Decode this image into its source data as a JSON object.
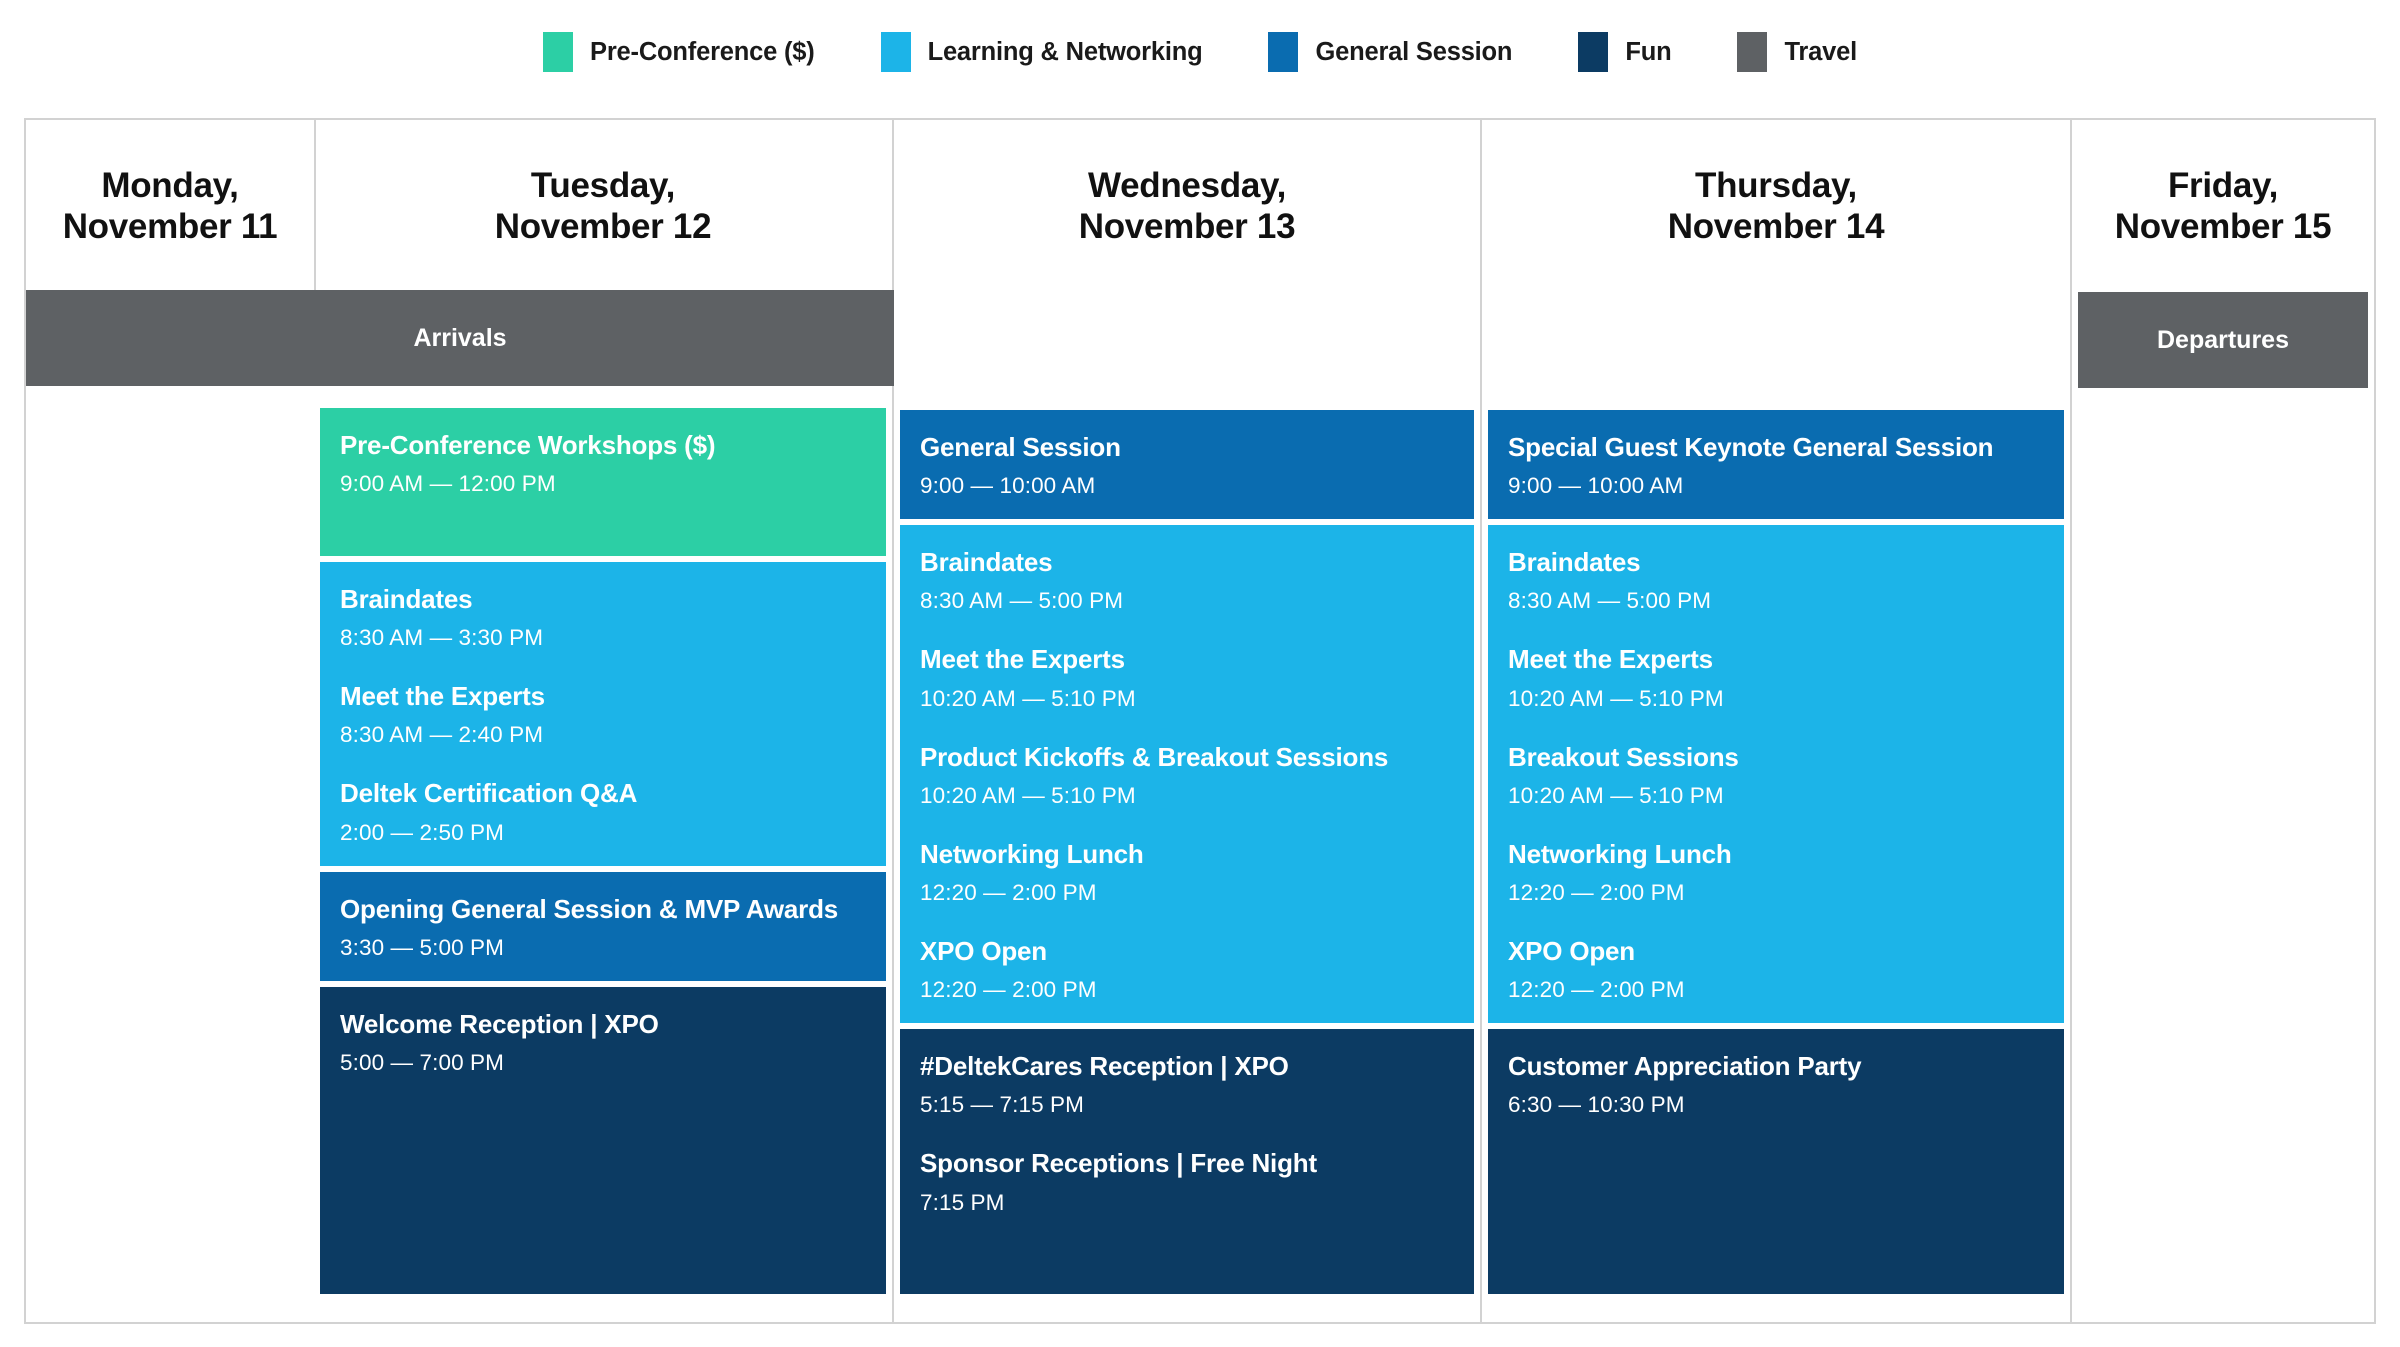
{
  "legend": {
    "items": [
      {
        "label": "Pre-Conference ($)",
        "color": "#2ccfa5",
        "key": "pre"
      },
      {
        "label": "Learning & Networking",
        "color": "#1cb4e8",
        "key": "learning"
      },
      {
        "label": "General Session",
        "color": "#0a6cb0",
        "key": "general"
      },
      {
        "label": "Fun",
        "color": "#0c3b63",
        "key": "fun"
      },
      {
        "label": "Travel",
        "color": "#5e6164",
        "key": "travel"
      }
    ]
  },
  "travel": {
    "arrivals_label": "Arrivals",
    "departures_label": "Departures"
  },
  "days": [
    {
      "dow": "Monday,",
      "date": "November 11"
    },
    {
      "dow": "Tuesday,",
      "date": "November 12"
    },
    {
      "dow": "Wednesday,",
      "date": "November 13"
    },
    {
      "dow": "Thursday,",
      "date": "November 14"
    },
    {
      "dow": "Friday,",
      "date": "November 15"
    }
  ],
  "tuesday": {
    "preconference": {
      "title": "Pre-Conference Workshops ($)",
      "time": "9:00 AM — 12:00 PM"
    },
    "learning": [
      {
        "title": "Braindates",
        "time": "8:30 AM — 3:30 PM"
      },
      {
        "title": "Meet the Experts",
        "time": "8:30 AM — 2:40 PM"
      },
      {
        "title": "Deltek Certification Q&A",
        "time": "2:00 — 2:50 PM"
      }
    ],
    "general": {
      "title": "Opening General Session & MVP Awards",
      "time": "3:30 — 5:00 PM"
    },
    "fun": [
      {
        "title": "Welcome Reception | XPO",
        "time": "5:00 — 7:00 PM"
      }
    ]
  },
  "wednesday": {
    "general": {
      "title": "General Session",
      "time": "9:00 — 10:00 AM"
    },
    "learning": [
      {
        "title": "Braindates",
        "time": "8:30 AM — 5:00 PM"
      },
      {
        "title": "Meet the Experts",
        "time": "10:20 AM — 5:10 PM"
      },
      {
        "title": "Product Kickoffs & Breakout Sessions",
        "time": "10:20 AM — 5:10 PM"
      },
      {
        "title": "Networking Lunch",
        "time": "12:20 — 2:00 PM"
      },
      {
        "title": "XPO Open",
        "time": "12:20 — 2:00 PM"
      }
    ],
    "fun": [
      {
        "title": "#DeltekCares Reception | XPO",
        "time": "5:15 — 7:15 PM"
      },
      {
        "title": "Sponsor Receptions | Free Night",
        "time": "7:15 PM"
      }
    ]
  },
  "thursday": {
    "general": {
      "title": "Special Guest Keynote General Session",
      "time": "9:00 — 10:00 AM"
    },
    "learning": [
      {
        "title": "Braindates",
        "time": "8:30 AM — 5:00 PM"
      },
      {
        "title": "Meet the Experts",
        "time": "10:20 AM — 5:10 PM"
      },
      {
        "title": "Breakout Sessions",
        "time": "10:20 AM — 5:10 PM"
      },
      {
        "title": "Networking Lunch",
        "time": "12:20 — 2:00 PM"
      },
      {
        "title": "XPO Open",
        "time": "12:20 — 2:00 PM"
      }
    ],
    "fun": [
      {
        "title": "Customer Appreciation Party",
        "time": "6:30 — 10:30 PM"
      }
    ]
  }
}
